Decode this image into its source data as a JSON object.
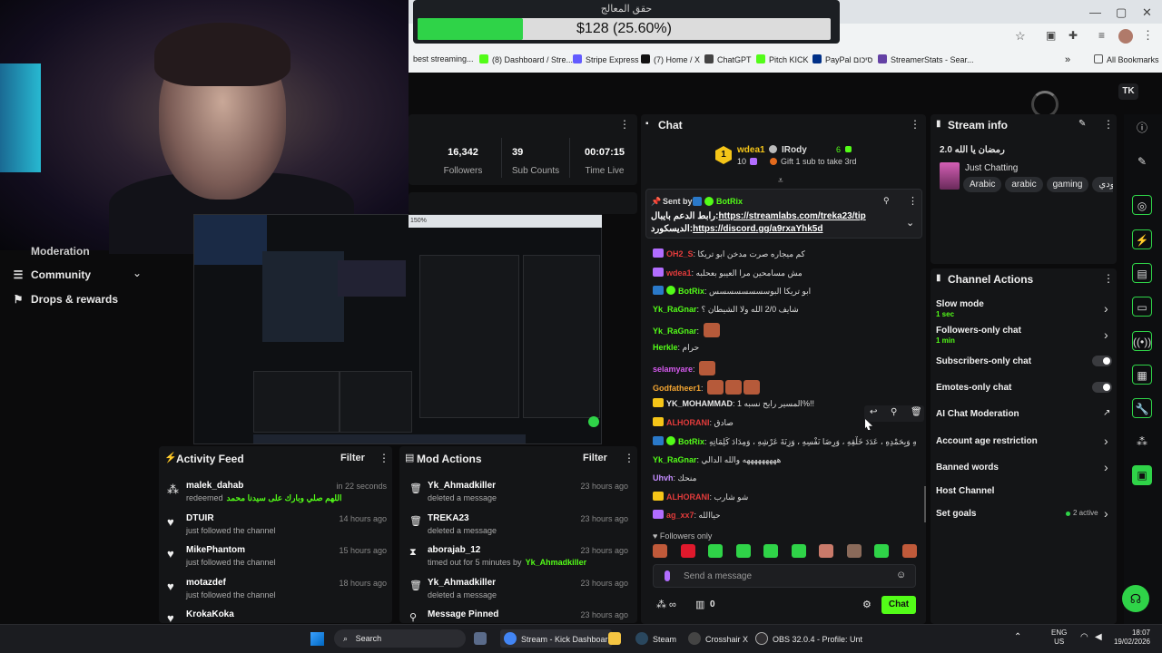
{
  "donation": {
    "title": "حقق المعالج",
    "amount": "$128 (25.60%)",
    "progress": 0.256,
    "color": "#2fd348"
  },
  "browser": {
    "bookmarks": [
      "best streaming...",
      "(8) Dashboard / Stre...",
      "Stripe Express",
      "(7) Home / X",
      "ChatGPT",
      "Pitch KICK",
      "PayPal סיכום",
      "StreamerStats - Sear..."
    ],
    "all_bookmarks": "All Bookmarks",
    "profile_initials": "TK"
  },
  "nav": {
    "moderation": "Moderation",
    "community": "Community",
    "drops": "Drops & rewards"
  },
  "stats": [
    {
      "value": "16,342",
      "label": "Followers"
    },
    {
      "value": "39",
      "label": "Sub Counts"
    },
    {
      "value": "00:07:15",
      "label": "Time Live"
    }
  ],
  "preview": {
    "zoom": "150%"
  },
  "activity": {
    "title": "Activity Feed",
    "filter": "Filter",
    "items": [
      {
        "user": "malek_dahab",
        "action": "redeemed",
        "extra": "اللهم صلي وبارك على سيدنا محمد",
        "time": "in 22 seconds",
        "icon": "people-icon"
      },
      {
        "user": "DTUIR",
        "action": "just followed the channel",
        "time": "14 hours ago",
        "icon": "heart-icon"
      },
      {
        "user": "MikePhantom",
        "action": "just followed the channel",
        "time": "15 hours ago",
        "icon": "heart-icon"
      },
      {
        "user": "motazdef",
        "action": "just followed the channel",
        "time": "18 hours ago",
        "icon": "heart-icon"
      },
      {
        "user": "KrokaKoka",
        "action": "",
        "time": "",
        "icon": "heart-icon"
      }
    ]
  },
  "modactions": {
    "title": "Mod Actions",
    "filter": "Filter",
    "items": [
      {
        "user": "Yk_Ahmadkiller",
        "action": "deleted a message",
        "time": "23 hours ago",
        "icon": "trash-icon"
      },
      {
        "user": "TREKA23",
        "action": "deleted a message",
        "time": "23 hours ago",
        "icon": "trash-icon"
      },
      {
        "user": "aborajab_12",
        "action": "timed out for 5 minutes by",
        "by": "Yk_Ahmadkiller",
        "time": "23 hours ago",
        "icon": "hourglass-icon"
      },
      {
        "user": "Yk_Ahmadkiller",
        "action": "deleted a message",
        "time": "23 hours ago",
        "icon": "trash-icon"
      },
      {
        "user": "Message Pinned",
        "action": "",
        "time": "23 hours ago",
        "icon": "pin-icon"
      }
    ]
  },
  "chat": {
    "title": "Chat",
    "leader": {
      "rank": "1",
      "name": "wdea1",
      "count": "10",
      "second": "IRody",
      "second_count": "6",
      "gift_text": "Gift 1 sub to take 3rd"
    },
    "pinned": {
      "sent_by": "Sent by",
      "bot": "BotRix",
      "line1_prefix": "رابط الدعم بايبال:",
      "link1": "https://streamlabs.com/treka23/tip",
      "line2_prefix": "الديسكورد:",
      "link2": "https://discord.gg/a9rxaYhk5d"
    },
    "messages": [
      {
        "user": "OH2_S",
        "color": "#e23b3b",
        "text": "كم ميجاره صرت مدخن ابو تريكا"
      },
      {
        "user": "wdea1",
        "color": "#e23b3b",
        "text": "مش مسامحين مرا العيبو بعحلبه"
      },
      {
        "user": "BotRix",
        "color": "#53fc18",
        "text": "ابو تريكا البوسسسسسسسس"
      },
      {
        "user": "Yk_RaGnar",
        "color": "#53fc18",
        "text": "شايف 2/0 الله ولا الشيطان ؟"
      },
      {
        "user": "Yk_RaGnar",
        "color": "#53fc18",
        "text": "",
        "emotes": 1
      },
      {
        "user": "Herkle",
        "color": "#53fc18",
        "text": "حرام"
      },
      {
        "user": "selamyare",
        "color": "#d65aef",
        "text": "",
        "emotes": 1
      },
      {
        "user": "Godfatheer1",
        "color": "#f2a431",
        "text": "",
        "emotes": 3
      },
      {
        "user": "YK_MOHAMMAD",
        "color": "#e8e8e8",
        "text": "المسير رايح نسبه 1%!!"
      },
      {
        "user": "ALHORANI",
        "color": "#e23b3b",
        "text": "صادق"
      },
      {
        "user": "BotRix",
        "color": "#53fc18",
        "text": "سُبْحَانَ اللهِ وَبِحَمْدِهِ ، عَدَدَ خَلْقِهِ ، وَرِضَا نَفْسِهِ ، وَزِنَةَ عَرْشِهِ ، وَمِدَادَ كَلِمَاتِهِ"
      },
      {
        "user": "Yk_RaGnar",
        "color": "#53fc18",
        "text": "هههههههههه والله الدالي"
      },
      {
        "user": "Uhvh",
        "color": "#c48cff",
        "text": "منحك"
      },
      {
        "user": "ALHORANI",
        "color": "#e23b3b",
        "text": "شو شارب"
      },
      {
        "user": "ag_xx7",
        "color": "#e23b3b",
        "text": "حياالله"
      }
    ],
    "followers_only": "Followers only",
    "input_placeholder": "Send a message",
    "footer_count": "0",
    "send_label": "Chat"
  },
  "stream_info": {
    "title": "Stream info",
    "stream_title": "رمضان يا الله 2.0",
    "category": "Just Chatting",
    "tags": [
      "Arabic",
      "arabic",
      "gaming",
      "سعودي"
    ]
  },
  "channel_actions": {
    "title": "Channel Actions",
    "items": [
      {
        "label": "Slow mode",
        "sub": "1 sec",
        "control": "chevron"
      },
      {
        "label": "Followers-only chat",
        "sub": "1 min",
        "control": "chevron"
      },
      {
        "label": "Subscribers-only chat",
        "sub": "",
        "control": "toggle"
      },
      {
        "label": "Emotes-only chat",
        "sub": "",
        "control": "toggle"
      },
      {
        "label": "AI Chat Moderation",
        "sub": "",
        "control": "external"
      },
      {
        "label": "Account age restriction",
        "sub": "",
        "control": "chevron"
      },
      {
        "label": "Banned words",
        "sub": "",
        "control": "chevron"
      },
      {
        "label": "Host Channel",
        "sub": "",
        "control": "none"
      },
      {
        "label": "Set goals",
        "sub": "",
        "control": "chevron",
        "status": "2 active"
      }
    ]
  },
  "taskbar": {
    "search": "Search",
    "apps": [
      {
        "label": "Stream - Kick Dashboar",
        "color": "#4285f4"
      },
      {
        "label": "Steam",
        "color": "#1b2838"
      },
      {
        "label": "Crosshair X",
        "color": "#333"
      },
      {
        "label": "OBS 32.0.4 - Profile: Unt",
        "color": "#302e31"
      }
    ],
    "lang": "ENG",
    "region": "US",
    "time": "18:07",
    "date": "19/02/2026"
  }
}
